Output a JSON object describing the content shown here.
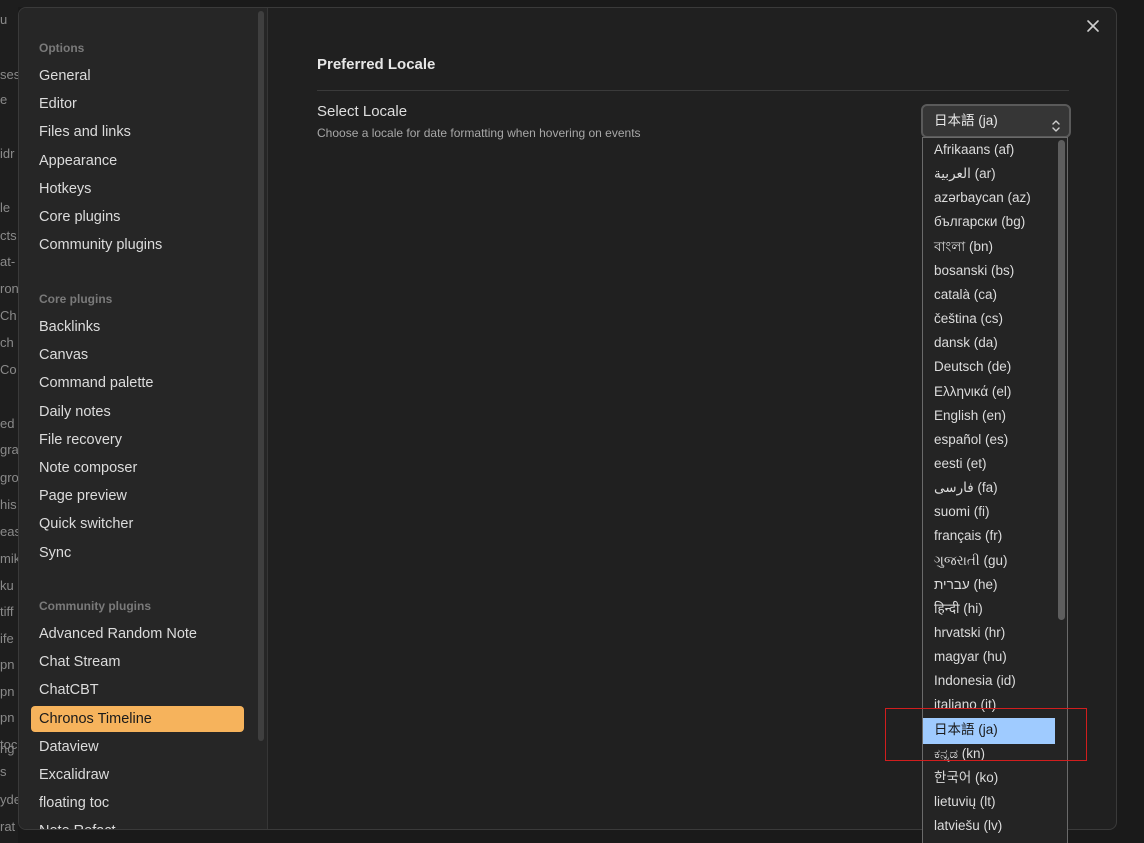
{
  "background_strip": [
    "u",
    "ses",
    "e",
    "idr",
    "le",
    "cts",
    "at-",
    "ron",
    "Ch",
    "ch",
    "Co",
    "ed",
    "gra",
    "gro",
    "his",
    "eas",
    "mik",
    "ku",
    "tiff",
    "ife",
    "pn",
    "pn",
    "pn",
    "toc",
    "s",
    "yde",
    "rat",
    "ng"
  ],
  "sidebar": {
    "options_title": "Options",
    "options": [
      "General",
      "Editor",
      "Files and links",
      "Appearance",
      "Hotkeys",
      "Core plugins",
      "Community plugins"
    ],
    "core_title": "Core plugins",
    "core": [
      "Backlinks",
      "Canvas",
      "Command palette",
      "Daily notes",
      "File recovery",
      "Note composer",
      "Page preview",
      "Quick switcher",
      "Sync"
    ],
    "community_title": "Community plugins",
    "community": [
      "Advanced Random Note",
      "Chat Stream",
      "ChatCBT",
      "Chronos Timeline",
      "Dataview",
      "Excalidraw",
      "floating toc",
      "Note Refact"
    ],
    "active_item": "Chronos Timeline"
  },
  "content": {
    "section_heading": "Preferred Locale",
    "setting_name": "Select Locale",
    "setting_desc": "Choose a locale for date formatting when hovering on events",
    "selected_value": "日本語 (ja)"
  },
  "dropdown": {
    "options": [
      "Afrikaans (af)",
      "العربية (ar)",
      "azərbaycan (az)",
      "български (bg)",
      "বাংলা (bn)",
      "bosanski (bs)",
      "català (ca)",
      "čeština (cs)",
      "dansk (da)",
      "Deutsch (de)",
      "Ελληνικά (el)",
      "English (en)",
      "español (es)",
      "eesti (et)",
      "فارسی (fa)",
      "suomi (fi)",
      "français (fr)",
      "ગુજરાતી (gu)",
      "עברית (he)",
      "हिन्दी (hi)",
      "hrvatski (hr)",
      "magyar (hu)",
      "Indonesia (id)",
      "italiano (it)",
      "日本語 (ja)",
      "ಕನ್ನಡ (kn)",
      "한국어 (ko)",
      "lietuvių (lt)",
      "latviešu (lv)"
    ],
    "selected": "日本語 (ja)"
  },
  "colors": {
    "accent": "#f6b35c",
    "selection": "#9fcbff",
    "annotation": "#d11e1e"
  }
}
